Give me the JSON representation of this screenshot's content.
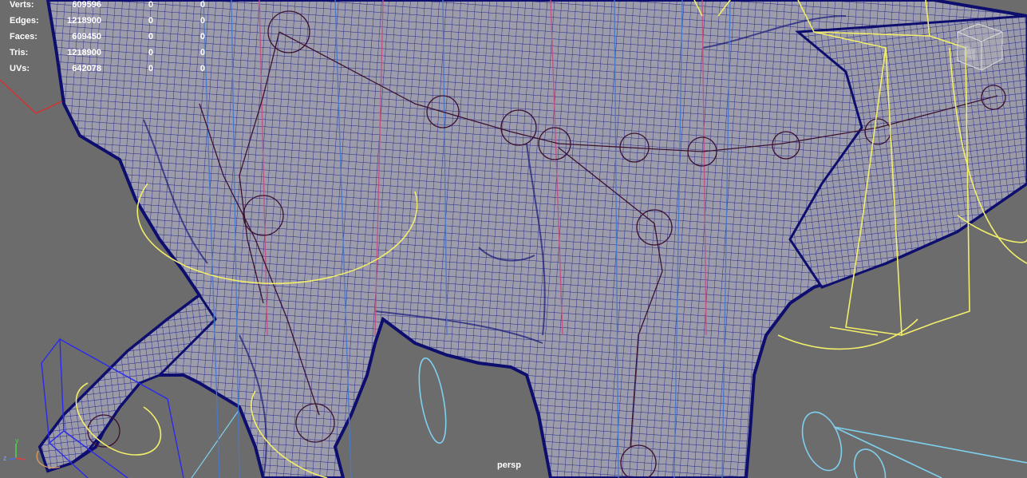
{
  "hud": {
    "rows": [
      {
        "label": "Verts:",
        "v1": "609596",
        "v2": "0",
        "v3": "0"
      },
      {
        "label": "Edges:",
        "v1": "1218900",
        "v2": "0",
        "v3": "0"
      },
      {
        "label": "Faces:",
        "v1": "609450",
        "v2": "0",
        "v3": "0"
      },
      {
        "label": "Tris:",
        "v1": "1218900",
        "v2": "0",
        "v3": "0"
      },
      {
        "label": "UVs:",
        "v1": "642078",
        "v2": "0",
        "v3": "0"
      }
    ]
  },
  "camera": {
    "name": "persp"
  },
  "axis": {
    "y": "y",
    "z": "z"
  },
  "colors": {
    "background": "#6c6c6c",
    "mesh_fill": "#9a9aa8",
    "wire": "#1c1c86",
    "wire_outline": "#0e0e6e",
    "joint": "#3b1030",
    "control_yellow": "#f2ee6a",
    "control_cyan": "#7fd0ee",
    "control_blue": "#2a2aee",
    "control_red": "#d83030"
  },
  "icons": {
    "axis": "axis-gizmo-icon",
    "view_cube": "view-cube-icon"
  }
}
